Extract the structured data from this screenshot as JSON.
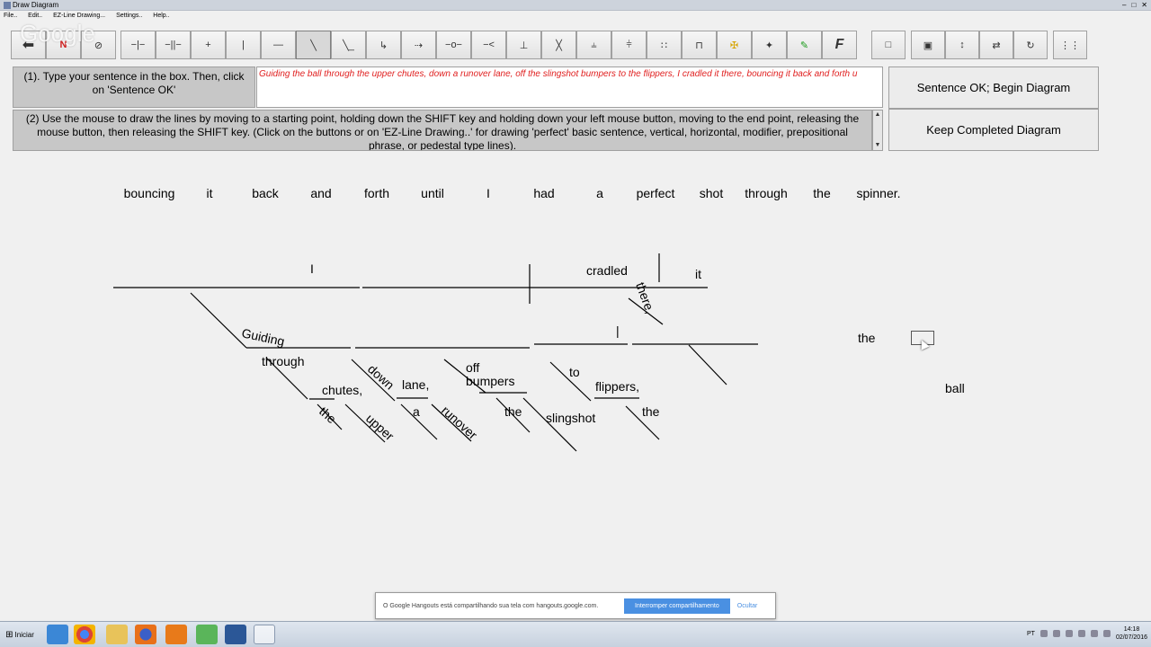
{
  "window": {
    "title": "Draw Diagram",
    "controls": [
      "–",
      "□",
      "✕"
    ]
  },
  "menu": [
    "File..",
    "Edit..",
    "EZ-Line Drawing...",
    "Settings..",
    "Help.."
  ],
  "watermark": "Google",
  "toolbar": {
    "buttons": [
      {
        "icon": "back-arrow-icon",
        "glyph": "⬅"
      },
      {
        "icon": "new-icon",
        "glyph": "N",
        "color": "#d02020"
      },
      {
        "icon": "eraser-icon",
        "glyph": "⊘"
      },
      {
        "icon": "basic-line-icon",
        "glyph": "−|−"
      },
      {
        "icon": "double-divider-icon",
        "glyph": "−||−"
      },
      {
        "icon": "cross-line-icon",
        "glyph": "+"
      },
      {
        "icon": "vertical-line-icon",
        "glyph": "|"
      },
      {
        "icon": "horizontal-line-icon",
        "glyph": "—"
      },
      {
        "icon": "slant-line-icon",
        "glyph": "╲",
        "pressed": true
      },
      {
        "icon": "modifier-line-icon",
        "glyph": "╲_"
      },
      {
        "icon": "prep-phrase-icon",
        "glyph": "↳"
      },
      {
        "icon": "arrow-line-icon",
        "glyph": "⇢"
      },
      {
        "icon": "circle-line-icon",
        "glyph": "−o−"
      },
      {
        "icon": "left-bracket-icon",
        "glyph": "−<"
      },
      {
        "icon": "pedestal-icon",
        "glyph": "⊥"
      },
      {
        "icon": "x-line-icon",
        "glyph": "╳"
      },
      {
        "icon": "fork-icon",
        "glyph": "⫨"
      },
      {
        "icon": "double-fork-icon",
        "glyph": "⫩"
      },
      {
        "icon": "dotted-icon",
        "glyph": "∷"
      },
      {
        "icon": "bracket-icon",
        "glyph": "⊓"
      },
      {
        "icon": "yellow-cross-icon",
        "glyph": "✠",
        "color": "#d6a400"
      },
      {
        "icon": "wand-icon",
        "glyph": "✦"
      },
      {
        "icon": "green-pencil-icon",
        "glyph": "✎",
        "color": "#1a9a1a"
      },
      {
        "icon": "font-icon",
        "glyph": "F"
      }
    ],
    "right_buttons": [
      {
        "icon": "square-icon",
        "glyph": "□"
      },
      {
        "icon": "picture-icon",
        "glyph": "▣"
      },
      {
        "icon": "vertical-move-icon",
        "glyph": "↕"
      },
      {
        "icon": "horizontal-move-icon",
        "glyph": "⇄"
      },
      {
        "icon": "redo-icon",
        "glyph": "↻"
      },
      {
        "icon": "grid-icon",
        "glyph": "⋮⋮"
      }
    ]
  },
  "step1": {
    "text": "(1). Type your sentence in the box. Then, click on 'Sentence OK'"
  },
  "sentence_input": {
    "value": "Guiding the ball through the upper chutes, down a runover lane, off the slingshot bumpers to the flippers, I cradled it there, bouncing it back and forth u"
  },
  "step2": {
    "text": "(2) Use the mouse to draw the lines by moving to a starting point, holding down the SHIFT key and holding down your left mouse button, moving to the end point, releasing the mouse button, then releasing the SHIFT key. (Click on the buttons or on 'EZ-Line Drawing..' for drawing 'perfect' basic sentence, vertical, horizontal, modifier, prepositional phrase, or pedestal type lines)."
  },
  "buttons": {
    "sentence_ok": "Sentence OK; Begin Diagram",
    "keep_diagram": "Keep Completed Diagram"
  },
  "remaining_words": [
    "bouncing",
    "it",
    "back",
    "and",
    "forth",
    "until",
    "I",
    "had",
    "a",
    "perfect",
    "shot",
    "through",
    "the",
    "spinner."
  ],
  "diagram_words": {
    "I": "I",
    "cradled": "cradled",
    "it": "it",
    "there": "there,",
    "guiding": "Guiding",
    "through": "through",
    "chutes": "chutes,",
    "the1": "the",
    "upper": "upper",
    "down": "down",
    "lane": "lane,",
    "a": "a",
    "runover": "runover",
    "off": "off",
    "bumpers": "bumpers",
    "the2": "the",
    "slingshot": "slingshot",
    "to": "to",
    "flippers": "flippers,",
    "the3": "the",
    "bar": "|",
    "the_free": "the",
    "ball_free": "ball"
  },
  "hangouts": {
    "message": "O Google Hangouts está compartilhando sua tela com hangouts.google.com.",
    "stop": "Interromper compartilhamento",
    "hide": "Ocultar"
  },
  "taskbar": {
    "start": "Iniciar",
    "lang": "PT",
    "time": "14:18",
    "date": "02/07/2016"
  }
}
